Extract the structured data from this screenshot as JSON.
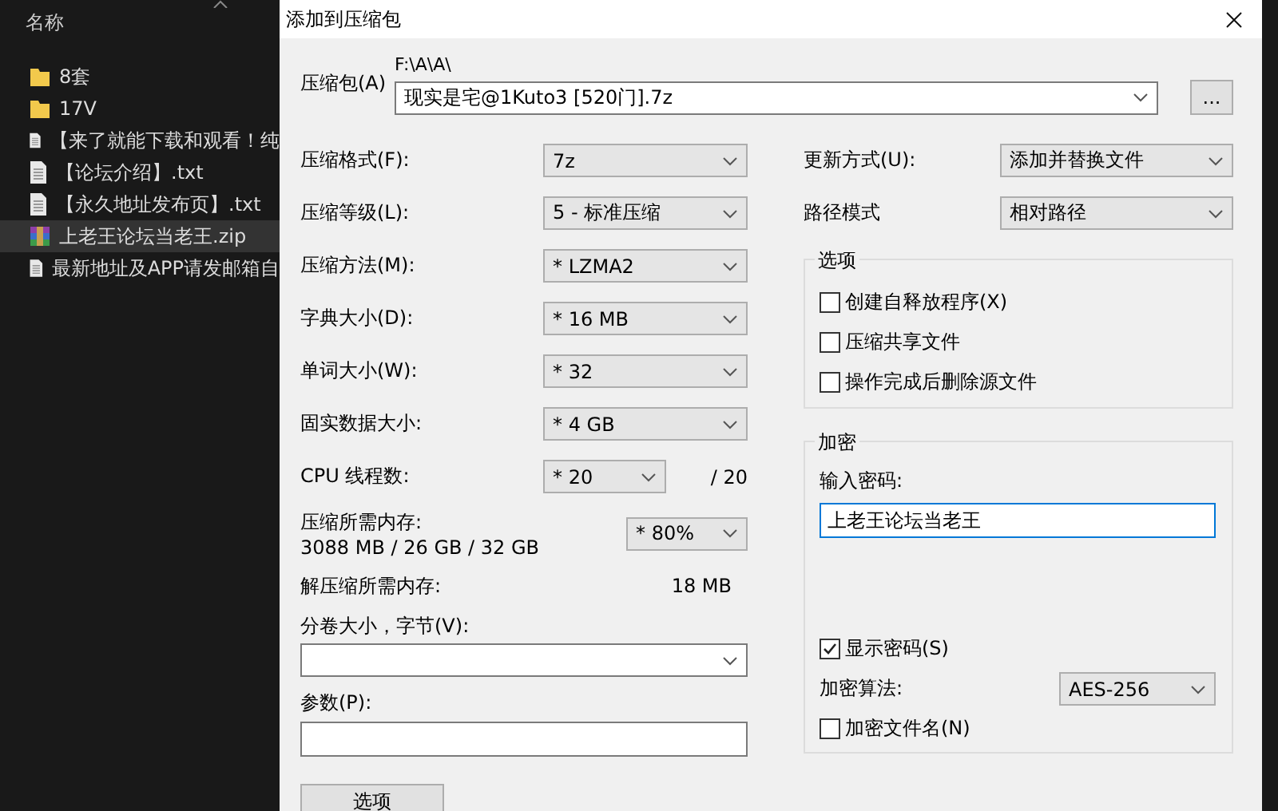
{
  "explorer": {
    "header": "名称",
    "items": [
      {
        "name": "8套",
        "kind": "folder",
        "selected": false
      },
      {
        "name": "17V",
        "kind": "folder",
        "selected": false
      },
      {
        "name": "【来了就能下载和观看！纯",
        "kind": "text",
        "selected": false
      },
      {
        "name": "【论坛介绍】.txt",
        "kind": "text",
        "selected": false
      },
      {
        "name": "【永久地址发布页】.txt",
        "kind": "text",
        "selected": false
      },
      {
        "name": "上老王论坛当老王.zip",
        "kind": "archive",
        "selected": true
      },
      {
        "name": "最新地址及APP请发邮箱自",
        "kind": "text",
        "selected": false
      }
    ]
  },
  "dialog": {
    "title": "添加到压缩包",
    "archive": {
      "label": "压缩包(A)",
      "path": "F:\\A\\A\\",
      "value": "现实是宅@1Kuto3 [520门].7z",
      "browse": "..."
    },
    "left_rows": [
      {
        "kind": "combo",
        "label": "压缩格式(F):",
        "value": "7z"
      },
      {
        "kind": "combo",
        "label": "压缩等级(L):",
        "value": "5 - 标准压缩"
      },
      {
        "kind": "combo",
        "label": "压缩方法(M):",
        "value": "*  LZMA2"
      },
      {
        "kind": "combo",
        "label": "字典大小(D):",
        "value": "*  16 MB"
      },
      {
        "kind": "combo",
        "label": "单词大小(W):",
        "value": "*  32"
      },
      {
        "kind": "combo",
        "label": "固实数据大小:",
        "value": "*  4 GB"
      },
      {
        "kind": "short",
        "label": "CPU 线程数:",
        "value": "*  20",
        "suffix": "/ 20"
      },
      {
        "kind": "memory",
        "label": "压缩所需内存:",
        "detail": "3088 MB / 26 GB / 32 GB",
        "value": "* 80%"
      },
      {
        "kind": "info",
        "label": "解压缩所需内存:",
        "value": "18 MB"
      }
    ],
    "volume": {
      "label": "分卷大小，字节(V):"
    },
    "params": {
      "label": "参数(P):"
    },
    "options_button": "选项",
    "update": {
      "label": "更新方式(U):",
      "value": "添加并替换文件"
    },
    "path_mode": {
      "label": "路径模式",
      "value": "相对路径"
    },
    "options_group": {
      "title": "选项",
      "items": [
        {
          "label": "创建自释放程序(X)",
          "checked": false
        },
        {
          "label": "压缩共享文件",
          "checked": false
        },
        {
          "label": "操作完成后删除源文件",
          "checked": false
        }
      ]
    },
    "encryption": {
      "title": "加密",
      "password_label": "输入密码:",
      "password": "上老王论坛当老王",
      "show_password": {
        "label": "显示密码(S)",
        "checked": true
      },
      "method_label": "加密算法:",
      "method": "AES-256",
      "encrypt_names": {
        "label": "加密文件名(N)",
        "checked": false
      }
    }
  }
}
